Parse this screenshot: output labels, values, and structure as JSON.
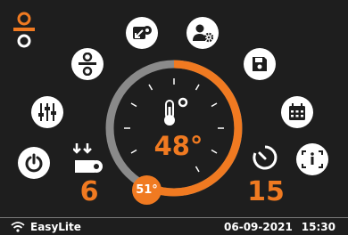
{
  "dial": {
    "temperature": "48°",
    "setpoint": "51°",
    "progress_fraction": 0.6
  },
  "left_value": "6",
  "right_value": "15",
  "status_bar": {
    "network_name": "EasyLite",
    "date": "06-09-2021",
    "time": "15:30"
  },
  "colors": {
    "accent": "#f07a21",
    "background": "#1e1e1e",
    "track": "#8a8a8a",
    "icon_bg": "#ffffff",
    "icon_fg": "#1e1e1e"
  },
  "icons": [
    "mode-icon",
    "divider-mode-icon",
    "pump-inlet-icon",
    "user-settings-icon",
    "save-icon",
    "equalizer-icon",
    "calendar-icon",
    "power-icon",
    "info-icon",
    "thermometer-icon",
    "flow-rate-icon",
    "timer-icon",
    "wifi-icon"
  ]
}
